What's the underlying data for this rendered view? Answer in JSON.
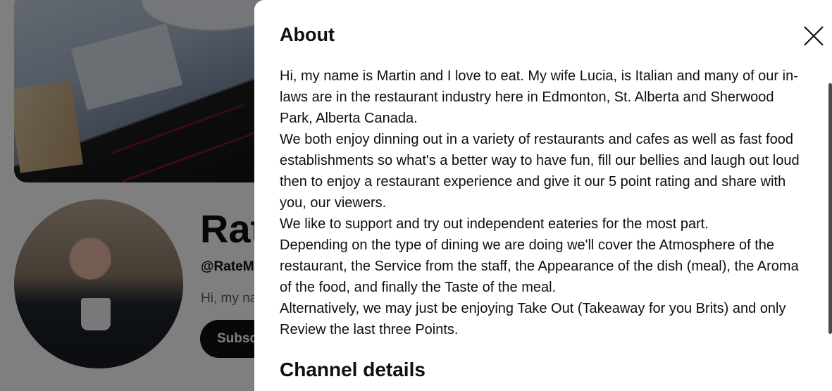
{
  "background_page": {
    "channel_name": "Rat",
    "channel_handle": "@RateM",
    "channel_description": "Hi, my na",
    "subscribe_label": "Subsc"
  },
  "dialog": {
    "title": "About",
    "close_icon": "close-icon",
    "description_paragraphs": [
      "Hi, my name is Martin and I love to eat. My wife Lucia, is Italian and many of our in-laws are in the restaurant industry here in Edmonton, St. Alberta and Sherwood Park, Alberta Canada.",
      "We both enjoy dinning out in a variety of restaurants and cafes as well as fast food establishments so what's a better way to have fun, fill our bellies and laugh out loud then to enjoy a restaurant experience and give it our 5 point rating and share with you, our viewers.",
      "We like to support and try out independent eateries for the most part.",
      "Depending on the type of dining we are doing we'll cover the Atmosphere of the restaurant, the Service from the staff, the Appearance of the dish (meal), the Aroma of the food, and finally the Taste of the meal.",
      "Alternatively, we may just be enjoying Take Out (Takeaway for you Brits) and only Review the last three Points."
    ],
    "channel_details_title": "Channel details"
  }
}
